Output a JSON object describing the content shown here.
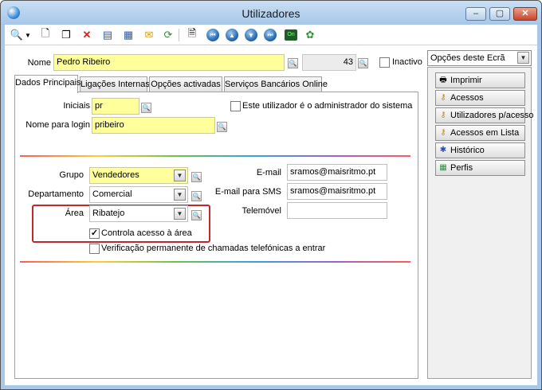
{
  "window": {
    "title": "Utilizadores",
    "buttons": [
      "‒",
      "▢",
      "✕"
    ]
  },
  "toolbar": {
    "icons": [
      "search-icon",
      "dropdown-arrow-icon",
      "new-document-icon",
      "copy-icon",
      "delete-icon",
      "properties-icon",
      "table-icon",
      "envelope-icon",
      "refresh-icon",
      "print-preview-icon",
      "first-record-icon",
      "previous-record-icon",
      "next-record-icon",
      "last-record-icon",
      "online-icon",
      "help-icon"
    ]
  },
  "header": {
    "name_label": "Nome",
    "name_value": "Pedro Ribeiro",
    "number_value": "43",
    "inactive_label": "Inactivo",
    "inactive_checked": false
  },
  "tabs": [
    "Dados Principais",
    "Ligações Internas",
    "Opções activadas",
    "Serviços Bancários Online"
  ],
  "form": {
    "initials_label": "Iniciais",
    "initials_value": "pr",
    "login_label": "Nome para login",
    "login_value": "pribeiro",
    "admin_label": "Este utilizador é o administrador do sistema",
    "admin_checked": false,
    "group_label": "Grupo",
    "group_value": "Vendedores",
    "department_label": "Departamento",
    "department_value": "Comercial",
    "area_label": "Área",
    "area_value": "Ribatejo",
    "area_control_label": "Controla acesso à área",
    "area_control_checked": true,
    "calls_verify_label": "Verificação permanente de chamadas telefónicas a entrar",
    "calls_verify_checked": false,
    "email_label": "E-mail",
    "email_value": "sramos@maisritmo.pt",
    "sms_email_label": "E-mail para SMS",
    "sms_email_value": "sramos@maisritmo.pt",
    "mobile_label": "Telemóvel",
    "mobile_value": ""
  },
  "sidebar": {
    "options_select": "Opções deste Ecrã",
    "buttons": [
      "Imprimir",
      "Acessos",
      "Utilizadores p/acesso",
      "Acessos em Lista",
      "Histórico",
      "Perfis"
    ]
  },
  "colors": {
    "required_field": "#ffff9c",
    "highlight_border": "#c0282d",
    "titlebar": "#a9c8e8"
  }
}
